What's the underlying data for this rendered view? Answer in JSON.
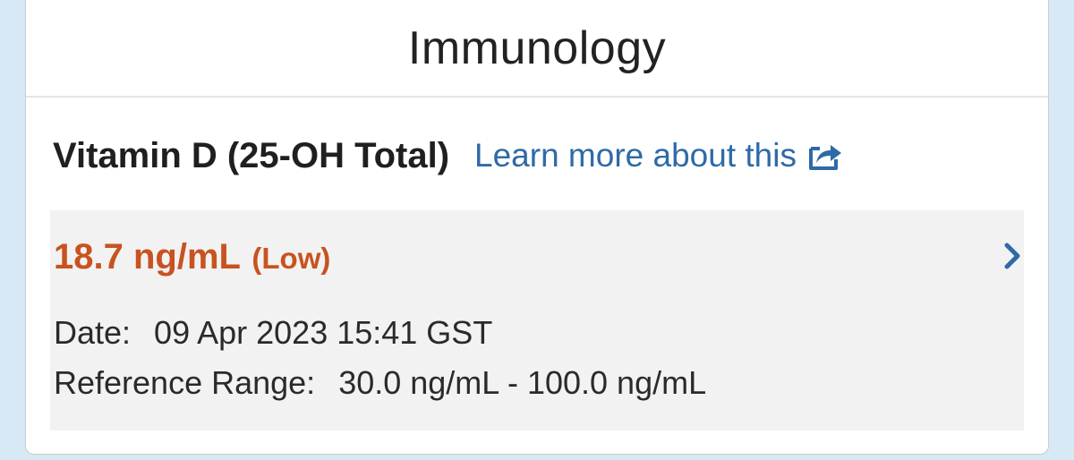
{
  "card": {
    "title": "Immunology"
  },
  "test": {
    "name": "Vitamin D (25-OH Total)",
    "learn_more_label": "Learn more about this",
    "learn_more_icon": "external-share-icon"
  },
  "result": {
    "value": "18.7 ng/mL",
    "flag": "(Low)",
    "flag_color": "#c8531f",
    "date_label": "Date:",
    "date_value": "09 Apr 2023 15:41 GST",
    "range_label": "Reference Range:",
    "range_value": "30.0 ng/mL - 100.0 ng/mL"
  },
  "colors": {
    "link": "#2f6aa6",
    "panel_background": "#f2f2f2",
    "page_background": "#d6e9f5"
  }
}
